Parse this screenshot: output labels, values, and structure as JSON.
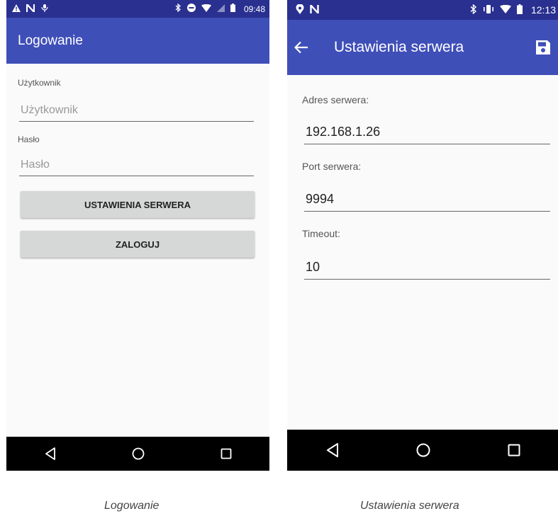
{
  "screens": [
    {
      "status_time": "09:48",
      "title": "Logowanie",
      "user_label": "Użytkownik",
      "user_placeholder": "Użytkownik",
      "password_label": "Hasło",
      "password_placeholder": "Hasło",
      "server_settings_button": "USTAWIENIA SERWERA",
      "login_button": "ZALOGUJ",
      "caption": "Logowanie"
    },
    {
      "status_time": "12:13",
      "title": "Ustawienia serwera",
      "address_label": "Adres serwera:",
      "address_value": "192.168.1.26",
      "port_label": "Port serwera:",
      "port_value": "9994",
      "timeout_label": "Timeout:",
      "timeout_value": "10",
      "caption": "Ustawienia serwera"
    }
  ],
  "icons": {
    "status_left_a": [
      "warning-icon",
      "n-notification-icon",
      "mic-icon"
    ],
    "status_right_a": [
      "bluetooth-icon",
      "do-not-disturb-icon",
      "wifi-icon",
      "no-signal-icon",
      "battery-icon"
    ],
    "status_left_b": [
      "location-icon",
      "n-notification-icon"
    ],
    "status_right_b": [
      "bluetooth-icon",
      "vibrate-icon",
      "wifi-icon",
      "battery-icon"
    ],
    "appbar_b": [
      "back-arrow-icon",
      "save-icon"
    ],
    "navbar": [
      "back-nav-icon",
      "home-nav-icon",
      "recents-nav-icon"
    ]
  },
  "colors": {
    "status_bar": "#29308f",
    "app_bar": "#3f4fb8",
    "button_bg": "#d6d7d7",
    "nav_bar": "#000000"
  }
}
